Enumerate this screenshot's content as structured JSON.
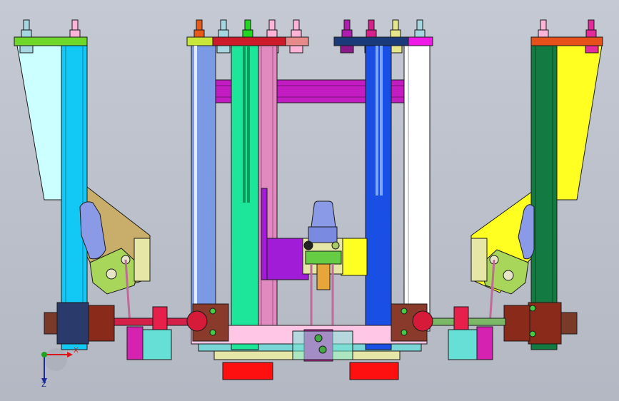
{
  "view": {
    "background_top": "#c4c9d3",
    "background_bottom": "#b3b8c3"
  },
  "triad": {
    "x_label": "X",
    "z_label": "Z",
    "x_color": "#d8161b",
    "y_color": "#1fa31f",
    "z_color": "#1a2a9a"
  },
  "palette": {
    "cyan_column": "#12c8f5",
    "green_column": "#1de59a",
    "blue_column": "#1a4fe6",
    "dark_green_column": "#137a42",
    "yellow_gusset": "#ffff22",
    "light_cyan_gusset": "#ccffff",
    "purple_beam": "#c21cc2",
    "pink_frame": "#e08ac0",
    "red_block": "#ff1010",
    "maroon_cylinder": "#8a2a1a"
  }
}
